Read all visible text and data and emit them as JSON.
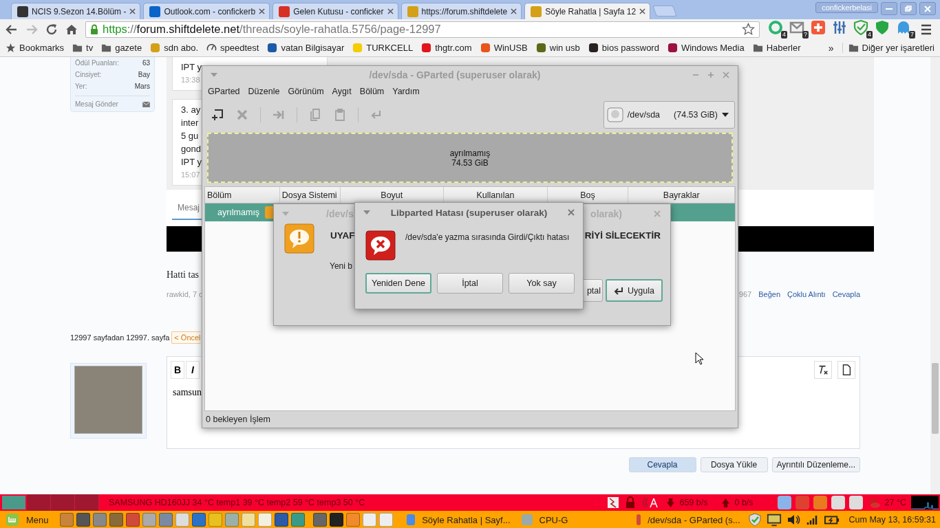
{
  "browser": {
    "tabs": [
      {
        "title": "NCIS 9.Sezon 14.Bölüm -",
        "selected": false
      },
      {
        "title": "Outlook.com - confickerb",
        "selected": false
      },
      {
        "title": "Gelen Kutusu - conficker",
        "selected": false
      },
      {
        "title": "https://forum.shiftdelete",
        "selected": false
      },
      {
        "title": "Söyle Rahatla | Sayfa 12",
        "selected": true
      }
    ],
    "profile": "confickerbelasi",
    "url": {
      "scheme": "https",
      "separator": "://",
      "host": "forum.shiftdelete.net",
      "path": "/threads/soyle-rahatla.5756/page-12997"
    },
    "extensions": [
      {
        "kind": "ring",
        "badge": "4"
      },
      {
        "kind": "mail",
        "badge": "?"
      },
      {
        "kind": "plus"
      },
      {
        "kind": "sliders"
      },
      {
        "kind": "shield-check",
        "badge": "4"
      },
      {
        "kind": "shield"
      },
      {
        "kind": "ghost",
        "badge": "7"
      }
    ],
    "bookmarks": [
      {
        "label": "Bookmarks",
        "kind": "star"
      },
      {
        "label": "tv",
        "kind": "folder"
      },
      {
        "label": "gazete",
        "kind": "folder"
      },
      {
        "label": "sdn abo.",
        "kind": "site",
        "color": "#d4a017"
      },
      {
        "label": "speedtest",
        "kind": "gauge"
      },
      {
        "label": "vatan Bilgisayar",
        "kind": "site",
        "color": "#1c5aa8"
      },
      {
        "label": "TURKCELL",
        "kind": "site",
        "color": "#f5cc00"
      },
      {
        "label": "thgtr.com",
        "kind": "site",
        "color": "#e0161b"
      },
      {
        "label": "WinUSB",
        "kind": "site",
        "color": "#e8541c"
      },
      {
        "label": "win usb",
        "kind": "site",
        "color": "#5a6a1a"
      },
      {
        "label": "bios password",
        "kind": "site",
        "color": "#2a2220"
      },
      {
        "label": "Windows Media",
        "kind": "site",
        "color": "#9b1140"
      },
      {
        "label": "Haberler",
        "kind": "folder"
      }
    ],
    "more": "»",
    "other_bookmarks": "Diğer yer işaretleri"
  },
  "forum": {
    "profile_stats": [
      {
        "label": "Ödül Puanları:",
        "value": "63"
      },
      {
        "label": "Cinsiyet:",
        "value": "Bay"
      },
      {
        "label": "Yer:",
        "value": "Mars"
      }
    ],
    "send_message": "Mesaj Gönder",
    "messages": [
      {
        "lines": [
          "IPT y"
        ],
        "time": "13:38"
      },
      {
        "lines": [
          "3. ay",
          "inter",
          "5 gu",
          "gond",
          "IPT y"
        ],
        "time": "15:07"
      }
    ],
    "message_placeholder": "Mesaj",
    "post_text": "Hatti tas",
    "post_meta": "rawkid, 7 c",
    "post_number": "967",
    "post_actions": [
      "Beğen",
      "Çoklu Alıntı",
      "Cevapla"
    ],
    "pagination": {
      "summary": "12997 sayfadan 12997. sayfa",
      "previous": "< Öncel"
    },
    "editor": {
      "tools": [
        "B",
        "I"
      ],
      "text": "samsun"
    },
    "reply_buttons": [
      {
        "label": "Cevapla",
        "primary": true
      },
      {
        "label": "Dosya Yükle",
        "primary": false
      },
      {
        "label": "Ayrıntılı Düzenleme...",
        "primary": false
      }
    ]
  },
  "gparted": {
    "title": "/dev/sda - GParted (superuser olarak)",
    "menu": [
      "GParted",
      "Düzenle",
      "Görünüm",
      "Aygıt",
      "Bölüm",
      "Yardım"
    ],
    "toolbar": [
      {
        "kind": "new",
        "disabled": false
      },
      {
        "kind": "delete",
        "disabled": true
      },
      {
        "kind": "sep"
      },
      {
        "kind": "resize",
        "disabled": true
      },
      {
        "kind": "sep"
      },
      {
        "kind": "copy",
        "disabled": true
      },
      {
        "kind": "paste",
        "disabled": true
      },
      {
        "kind": "sep"
      },
      {
        "kind": "apply",
        "disabled": true
      }
    ],
    "device": "/dev/sda",
    "device_size": "(74.53 GiB)",
    "map": {
      "label": "ayrılmamış",
      "size": "74.53 GiB"
    },
    "columns": [
      "Bölüm",
      "Dosya Sistemi",
      "Boyut",
      "Kullanılan",
      "Boş",
      "Bayraklar"
    ],
    "rows": [
      {
        "partition": "ayrılmamış",
        "warning": true,
        "selected": true
      }
    ],
    "status": "0 bekleyen İşlem"
  },
  "warning_dialog": {
    "title_start": "/dev/s",
    "title_end": "olarak)",
    "heading_start": "UYAF",
    "heading_end": "RİYİ SİLECEKTİR",
    "body": "Yeni b",
    "buttons": [
      {
        "label": "ptal",
        "focused": false
      },
      {
        "label": "Uygula",
        "focused": true
      }
    ]
  },
  "error_dialog": {
    "title": "Libparted Hatası (superuser olarak)",
    "message": "/dev/sda'e yazma sırasında Girdi/Çıktı hatası",
    "buttons": [
      {
        "label": "Yeniden Dene",
        "focused": true
      },
      {
        "label": "İptal",
        "focused": false
      },
      {
        "label": "Yok say",
        "focused": false
      }
    ]
  },
  "panel_top": {
    "sensors": "SAMSUNG HD160JJ 34 °C temp1 39 °C temp2 59 °C temp3 50 °C",
    "download": "659 b/s",
    "upload": "0 b/s",
    "weather": "27 °C"
  },
  "panel_bottom": {
    "menu": "Menu",
    "windows": [
      "Söyle Rahatla | Sayf...",
      "CPU-G",
      "/dev/sda - GParted (s..."
    ],
    "clock": "Cum May 13, 16:59:31"
  }
}
